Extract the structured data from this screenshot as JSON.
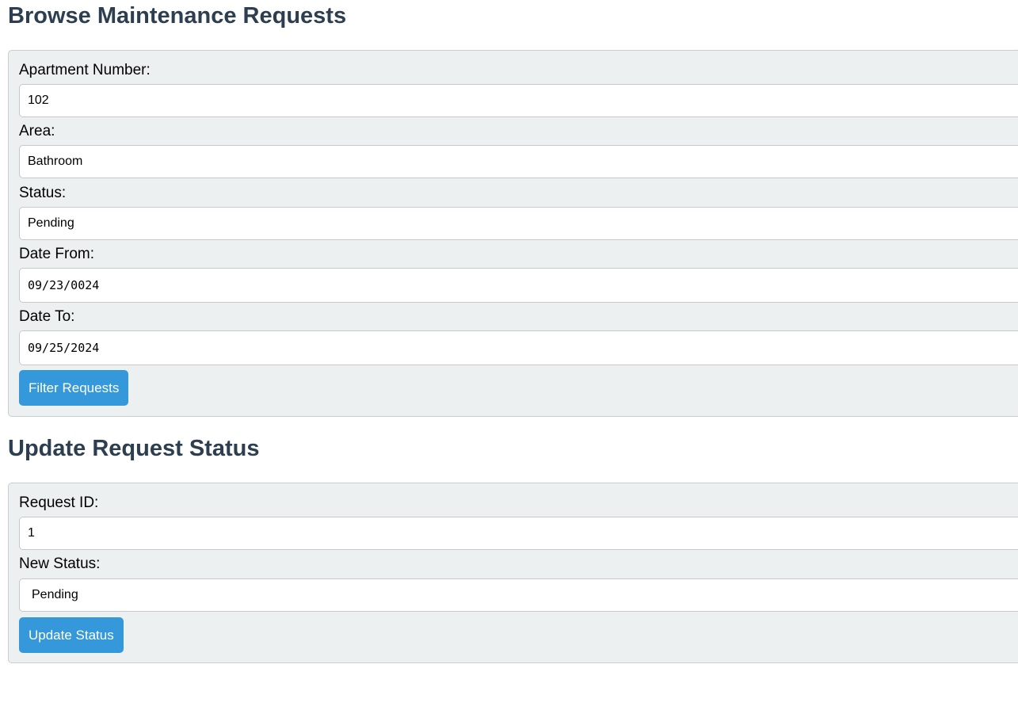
{
  "browse": {
    "title": "Browse Maintenance Requests",
    "apartment_label": "Apartment Number:",
    "apartment_value": "102",
    "area_label": "Area:",
    "area_value": "Bathroom",
    "status_label": "Status:",
    "status_value": "Pending",
    "date_from_label": "Date From:",
    "date_from_value": "09/23/0024",
    "date_to_label": "Date To:",
    "date_to_value": "09/25/2024",
    "filter_button": "Filter Requests"
  },
  "update": {
    "title": "Update Request Status",
    "request_id_label": "Request ID:",
    "request_id_value": "1",
    "new_status_label": "New Status:",
    "new_status_value": "Pending",
    "update_button": "Update Status"
  },
  "colors": {
    "heading": "#2c3e50",
    "panel_bg": "#ecf0f1",
    "button_bg": "#3498db"
  }
}
